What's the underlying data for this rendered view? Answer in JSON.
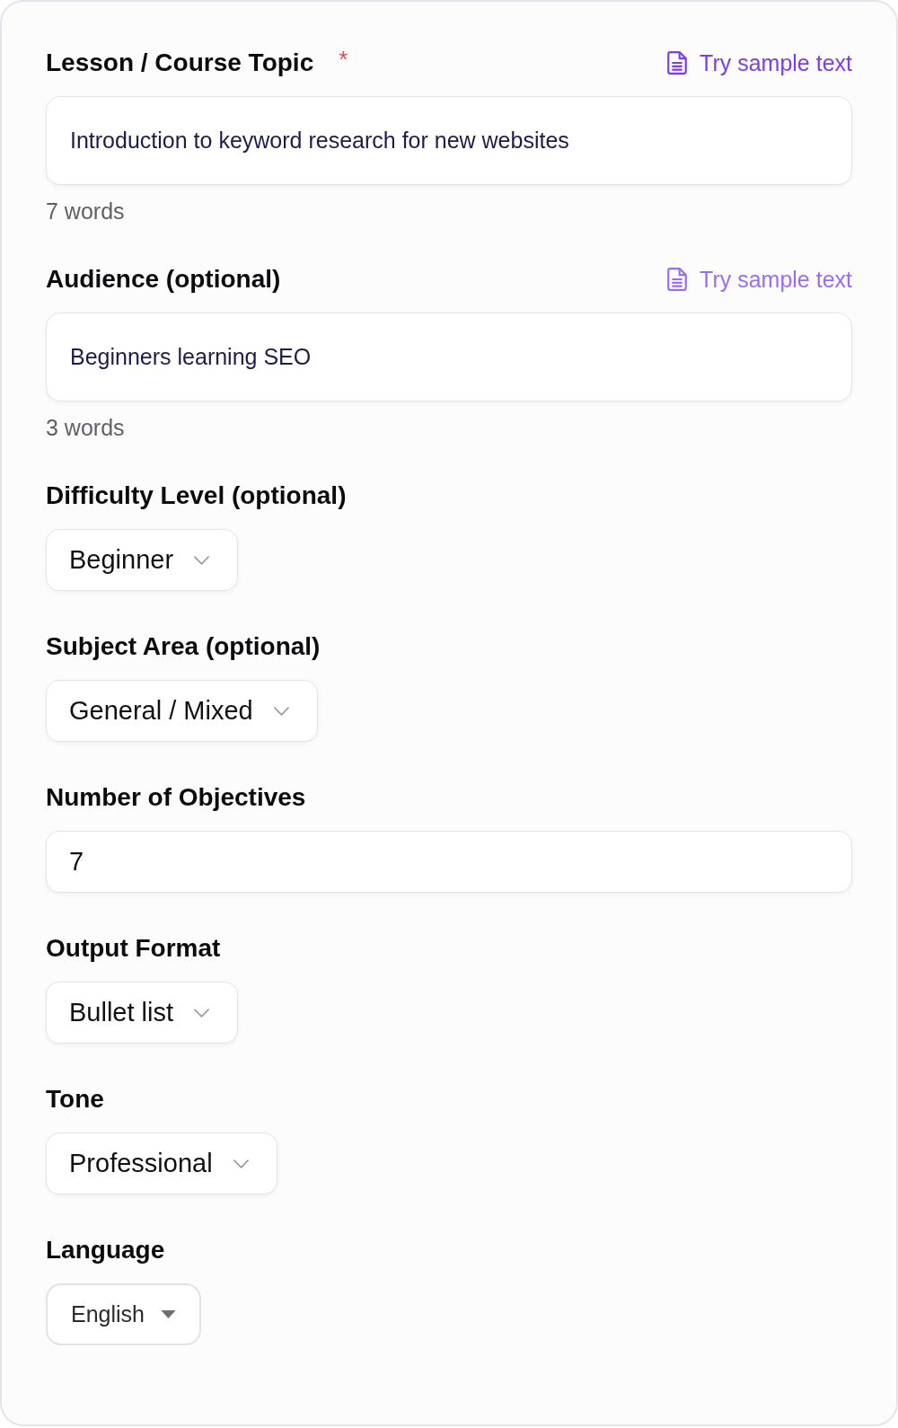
{
  "fields": [
    {
      "kind": "text",
      "label": "Lesson / Course Topic",
      "required_mark": "*",
      "sample_link": {
        "label": "Try sample text",
        "hovered": true
      },
      "value": "Introduction to keyword research for new websites",
      "word_count": "7 words"
    },
    {
      "kind": "text",
      "label": "Audience (optional)",
      "sample_link": {
        "label": "Try sample text",
        "hovered": false
      },
      "value": "Beginners learning SEO",
      "word_count": "3 words"
    },
    {
      "kind": "select",
      "label": "Difficulty Level (optional)",
      "value": "Beginner"
    },
    {
      "kind": "select",
      "label": "Subject Area (optional)",
      "value": "General / Mixed"
    },
    {
      "kind": "number",
      "label": "Number of Objectives",
      "value": "7"
    },
    {
      "kind": "select",
      "label": "Output Format",
      "value": "Bullet list"
    },
    {
      "kind": "select",
      "label": "Tone",
      "value": "Professional"
    },
    {
      "kind": "native_select",
      "label": "Language",
      "value": "English"
    }
  ]
}
